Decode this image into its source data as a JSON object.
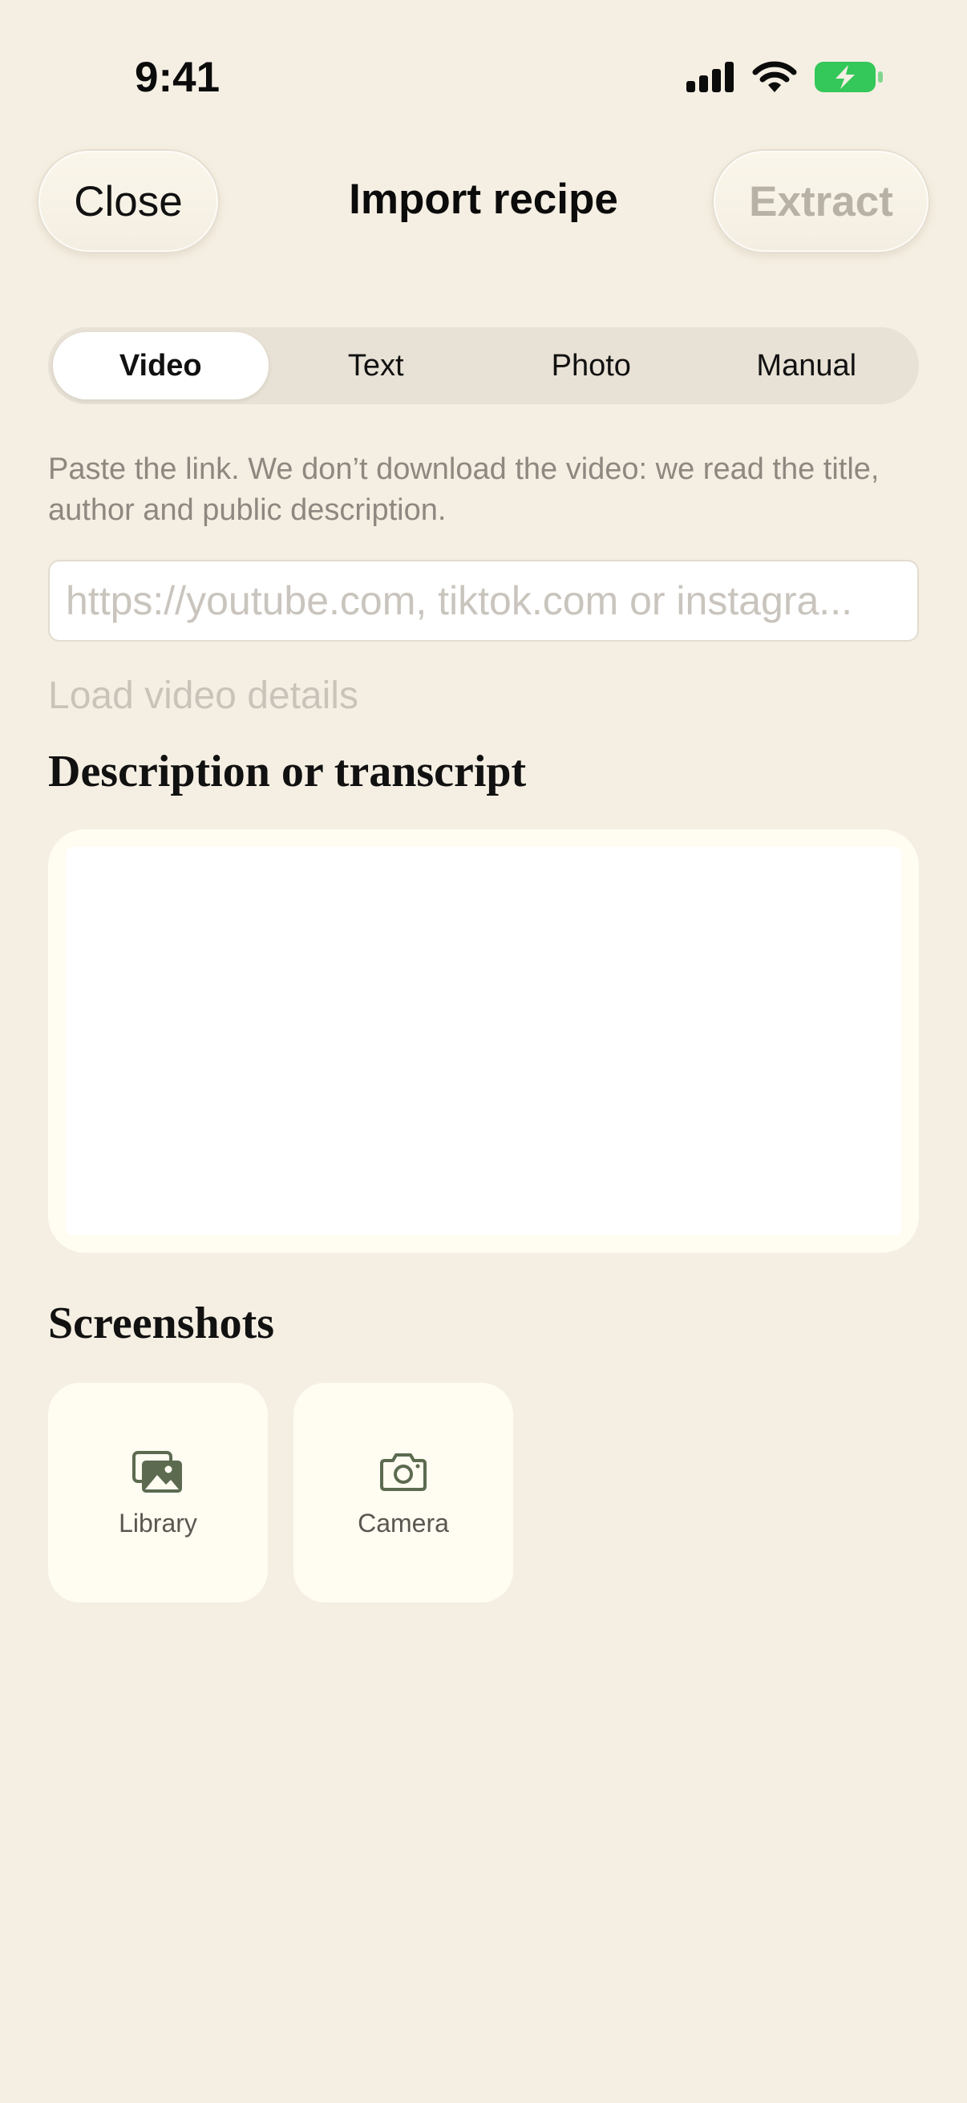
{
  "status_bar": {
    "time": "9:41",
    "icons": [
      "cellular-signal-icon",
      "wifi-icon",
      "battery-charging-icon"
    ],
    "battery_color": "#34C759"
  },
  "nav": {
    "close_label": "Close",
    "title": "Import recipe",
    "extract_label": "Extract"
  },
  "tabs": [
    {
      "label": "Video",
      "selected": true
    },
    {
      "label": "Text",
      "selected": false
    },
    {
      "label": "Photo",
      "selected": false
    },
    {
      "label": "Manual",
      "selected": false
    }
  ],
  "video": {
    "help_text": "Paste the link. We don’t download the video: we read the title, author and public description.",
    "url_value": "",
    "url_placeholder": "https://youtube.com, tiktok.com or instagra...",
    "load_label": "Load video details"
  },
  "description": {
    "heading": "Description or transcript",
    "value": ""
  },
  "screenshots": {
    "heading": "Screenshots",
    "library_label": "Library",
    "library_icon": "photo-library-icon",
    "camera_label": "Camera",
    "camera_icon": "camera-icon"
  },
  "colors": {
    "background": "#F5EFE3",
    "icon_green": "#5C6B50",
    "disabled_text": "#B8B1A6"
  }
}
